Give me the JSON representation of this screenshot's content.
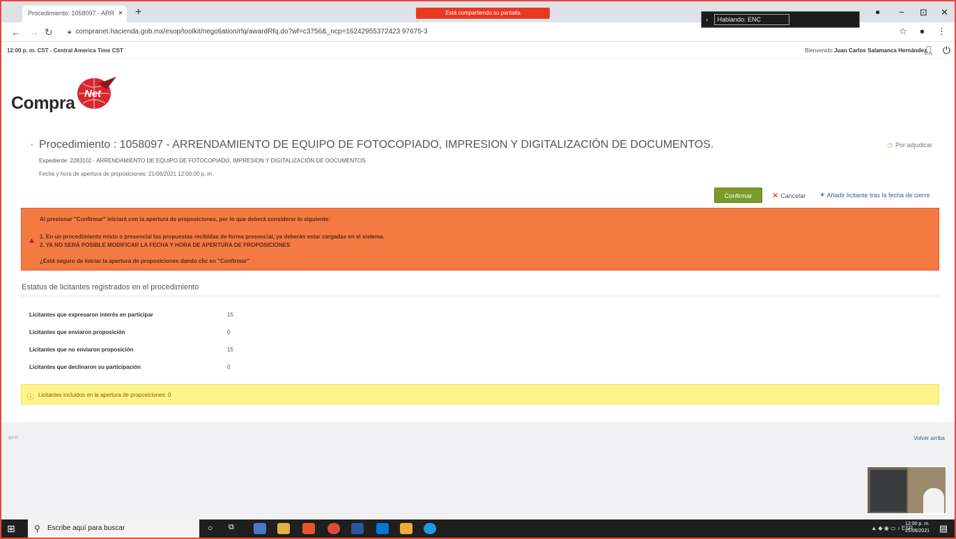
{
  "browser": {
    "tab_title": "Procedimiento: 1058097 - ARR",
    "tab_close": "×",
    "new_tab": "+",
    "share_banner": "Está compartiendo su pantalla",
    "cast_label": "Hablando: ENC",
    "url": "compranet.hacienda.gob.mx/esop/toolkit/negotiation/rfq/awardRfq.do?wf=c3756&_ncp=16242955372423 97675-3",
    "win_minimize": "−",
    "win_maximize": "⊡",
    "win_close": "✕"
  },
  "header": {
    "clock": "12:00 p. m. CST - Central America Time CST",
    "welcome_prefix": "Bienvenido",
    "user_name": "Juan Carlos Salamanca Hernández",
    "logo_text": "Compra",
    "logo_badge": "Net"
  },
  "procedure": {
    "title": "Procedimiento : 1058097 - ARRENDAMIENTO DE EQUIPO DE FOTOCOPIADO, IMPRESION Y DIGITALIZACIÓN DE DOCUMENTOS.",
    "status": "Por adjudicar",
    "expediente": "Expediente: 2283102 - ARRENDAMIENTO DE EQUIPO DE FOTOCOPIADO, IMPRESION Y DIGITALIZACIÓN DE DOCUMENTOS",
    "fecha": "Fecha y hora de apertura de proposiciones: 21/06/2021 12:00:00 p. m."
  },
  "actions": {
    "confirm": "Confirmar",
    "cancel": "Cancelar",
    "add": "Añadir licitante tras la fecha de cierre"
  },
  "warning": {
    "line1": "Al presionar \"Confirmar\" iniciará con la apertura de proposiciones, por lo que deberá considerar lo siguiente:",
    "line2": "1. En un procedimiento mixto o presencial las propuestas recibidas de forma presencial, ya deberán estar cargadas en el sistema.",
    "line3": "2. YA NO SERÁ POSIBLE MODIFICAR LA FECHA Y HORA DE APERTURA DE PROPOSICIONES",
    "line4": "¿Está seguro de iniciar la apertura de proposiciones dando clic en \"Confirmar\""
  },
  "status_section": {
    "title": "Estatus de licitantes registrados en el procedimiento",
    "rows": [
      {
        "label": "Licitantes que expresaron interés en participar",
        "value": "15"
      },
      {
        "label": "Licitantes que enviaron proposición",
        "value": "0"
      },
      {
        "label": "Licitantes que no enviaron proposición",
        "value": "15"
      },
      {
        "label": "Licitantes que declinaron su participación",
        "value": "0"
      }
    ],
    "info": "Licitantes incluidos en la apertura de proposiciones: 0"
  },
  "footer": {
    "left": "BPR",
    "volver": "Volver arriba"
  },
  "taskbar": {
    "search_placeholder": "Escribe aquí para buscar",
    "time": "12:00 p. m.",
    "date": "21/06/2021",
    "tray": "ESP"
  },
  "colors": {
    "confirm_green": "#7a9a2a",
    "warning_orange": "#f47a44",
    "info_yellow": "#fdf58a",
    "share_red": "#e8391f"
  }
}
